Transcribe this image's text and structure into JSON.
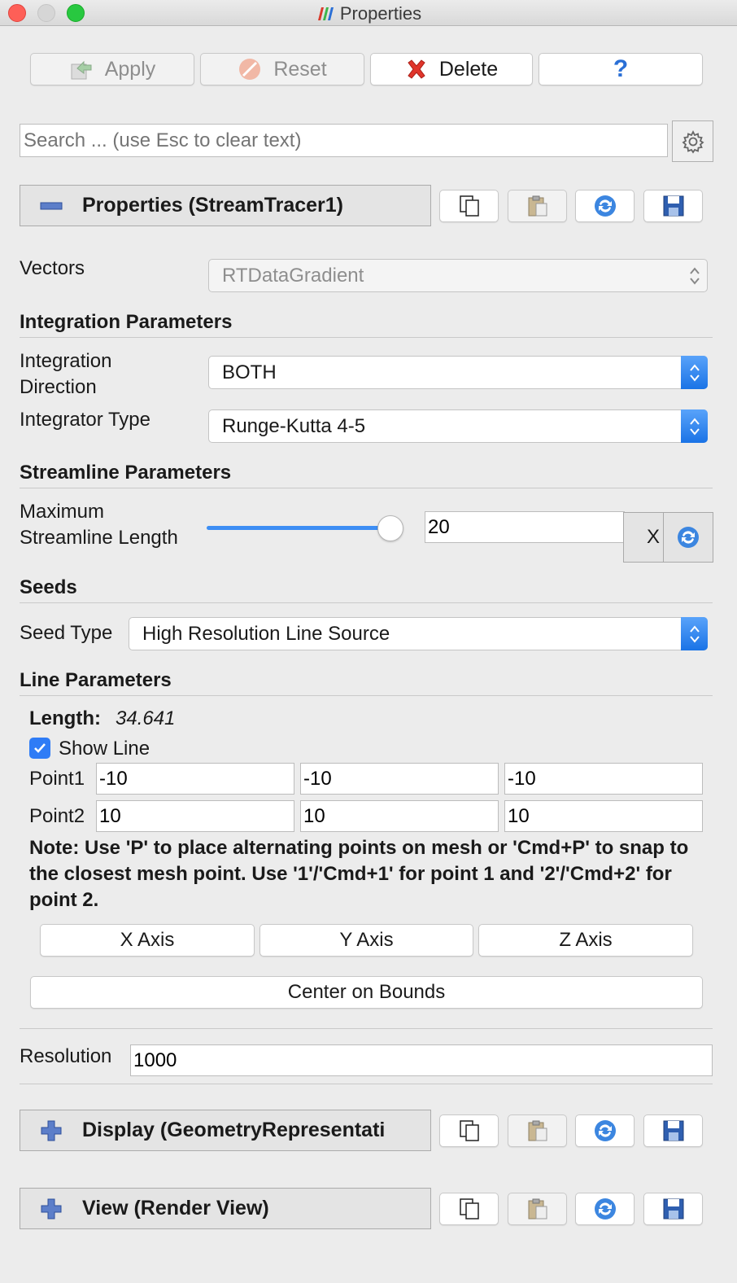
{
  "window": {
    "title": "Properties"
  },
  "toolbar": {
    "apply_label": "Apply",
    "reset_label": "Reset",
    "delete_label": "Delete",
    "help_label": "?"
  },
  "search": {
    "placeholder": "Search ... (use Esc to clear text)"
  },
  "properties_section": {
    "title": "Properties (StreamTracer1)"
  },
  "vectors": {
    "label": "Vectors",
    "value": "RTDataGradient"
  },
  "integration": {
    "title": "Integration Parameters",
    "direction_label_1": "Integration",
    "direction_label_2": "Direction",
    "direction_value": "BOTH",
    "type_label": "Integrator Type",
    "type_value": "Runge-Kutta 4-5"
  },
  "streamline": {
    "title": "Streamline Parameters",
    "max_label_1": "Maximum",
    "max_label_2": "Streamline Length",
    "max_value": "20",
    "x_label": "X"
  },
  "seeds": {
    "title": "Seeds",
    "seed_type_label": "Seed Type",
    "seed_type_value": "High Resolution Line Source"
  },
  "line": {
    "title": "Line Parameters",
    "length_label": "Length:",
    "length_value": "34.641",
    "show_line_label": "Show Line",
    "show_line_checked": true,
    "point1_label": "Point1",
    "point1": [
      "-10",
      "-10",
      "-10"
    ],
    "point2_label": "Point2",
    "point2": [
      "10",
      "10",
      "10"
    ],
    "note": "Note: Use 'P' to place alternating points on mesh or 'Cmd+P' to snap to the closest mesh point. Use '1'/'Cmd+1' for point 1 and '2'/'Cmd+2' for point 2.",
    "x_axis": "X Axis",
    "y_axis": "Y Axis",
    "z_axis": "Z Axis",
    "center_on_bounds": "Center on Bounds"
  },
  "resolution": {
    "label": "Resolution",
    "value": "1000"
  },
  "display_section": {
    "title": "Display (GeometryRepresentati"
  },
  "view_section": {
    "title": "View (Render View)"
  },
  "colors": {
    "accent": "#2f7cf6",
    "delete_red": "#e0352b"
  }
}
